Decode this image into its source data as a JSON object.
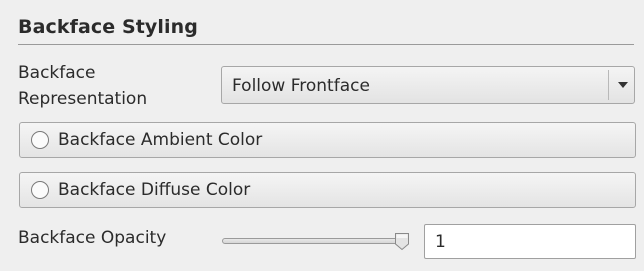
{
  "section": {
    "title": "Backface Styling"
  },
  "representation": {
    "label": "Backface Representation",
    "selected_value": "Follow Frontface",
    "dropdown_icon": "chevron-down-icon"
  },
  "ambient_color": {
    "label": "Backface Ambient Color"
  },
  "diffuse_color": {
    "label": "Backface Diffuse Color"
  },
  "opacity": {
    "label": "Backface Opacity",
    "value_text": "1",
    "slider_fraction": 1.0
  },
  "colors": {
    "background": "#efefef",
    "text": "#2b2b2b",
    "border": "#a7a7a7"
  }
}
